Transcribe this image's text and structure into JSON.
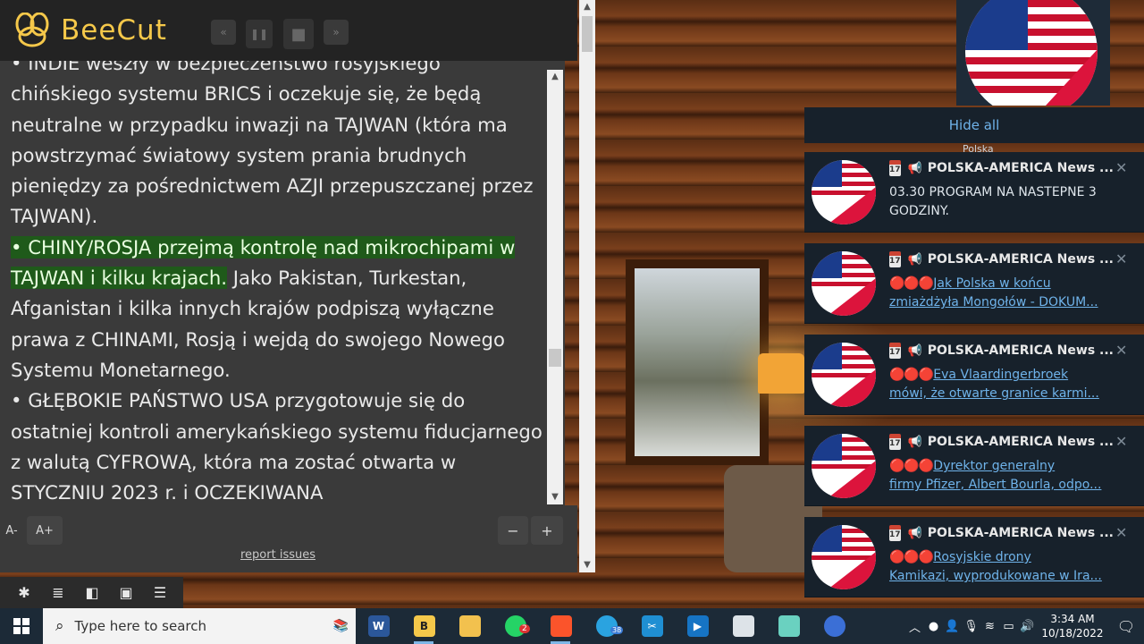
{
  "app": {
    "name": "BeeCut"
  },
  "recorder": {
    "rewind": "«",
    "pause": "❚❚",
    "stop": "■",
    "forward": "»"
  },
  "reader": {
    "paragraphs": [
      {
        "text": "• INDIE weszły w bezpieczeństwo rosyjskiego chińskiego systemu BRICS i oczekuje się, że będą neutralne w przypadku inwazji na TAJWAN (która ma powstrzymać światowy system prania brudnych pieniędzy za pośrednictwem AZJI przepuszczanej przez TAJWAN)."
      },
      {
        "highlight": "• CHINY/ROSJA przejmą kontrolę nad mikrochipami w TAJWAN i kilku krajach.",
        "text": " Jako Pakistan, Turkestan, Afganistan i kilka innych krajów podpiszą wyłączne prawa z CHINAMI, Rosją i wejdą do swojego Nowego Systemu Monetarnego."
      },
      {
        "text": "• GŁĘBOKIE PAŃSTWO USA przygotowuje się do ostatniej kontroli amerykańskiego systemu fiducjarnego z walutą CYFROWĄ, która ma zostać otwarta w STYCZNIU 2023 r. i OCZEKIWANA"
      }
    ],
    "font_decrease": "A-",
    "font_increase": "A+",
    "zoom_minus": "−",
    "zoom_plus": "+",
    "report": "report issues"
  },
  "notifications": {
    "hide_all": "Hide all",
    "peek": "Polska",
    "items": [
      {
        "channel": "POLSKA-AMERICA News ...",
        "line1": "03.30 PROGRAM NA NASTEPNE 3",
        "line2": "GODZINY.",
        "linked": false,
        "dots": ""
      },
      {
        "channel": "POLSKA-AMERICA News ...",
        "line1": "Jak Polska w końcu",
        "line2": "zmiażdżyła Mongołów - DOKUM...",
        "linked": true,
        "dots": "🔴🔴🔴"
      },
      {
        "channel": "POLSKA-AMERICA News ...",
        "line1": "Eva Vlaardingerbroek",
        "line2": "mówi, że otwarte granice karmi...",
        "linked": true,
        "dots": "🔴🔴🔴"
      },
      {
        "channel": "POLSKA-AMERICA News ...",
        "line1": "Dyrektor generalny",
        "line2": "firmy Pfizer, Albert Bourla, odpo...",
        "linked": true,
        "dots": "🔴🔴🔴"
      },
      {
        "channel": "POLSKA-AMERICA News ...",
        "line1": "Rosyjskie drony",
        "line2": "Kamikazi, wyprodukowane w Ira...",
        "linked": true,
        "dots": "🔴🔴🔴"
      }
    ],
    "calendar_day": "17"
  },
  "taskbar": {
    "search_placeholder": "Type here to search",
    "whatsapp_badge": "2",
    "telegram_badge": "38",
    "time": "3:34 AM",
    "date": "10/18/2022"
  },
  "colors": {
    "accent": "#f5c84a",
    "highlight": "#1f5a1a",
    "link": "#6fb3ea"
  }
}
